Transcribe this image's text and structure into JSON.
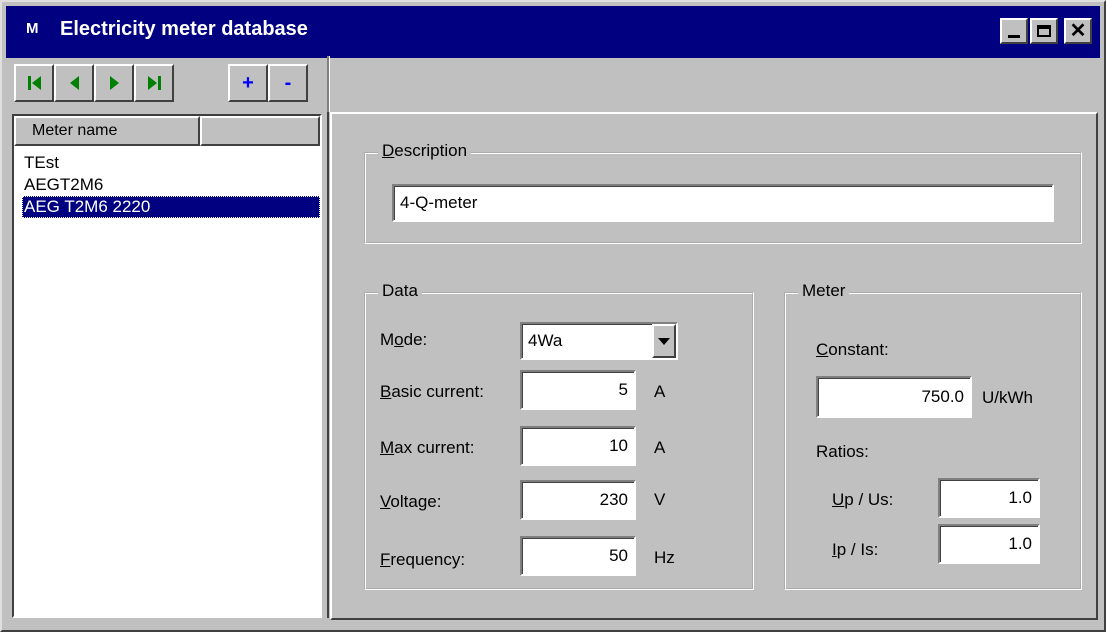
{
  "window": {
    "app_icon": "M",
    "title": "Electricity meter database",
    "controls": {
      "minimize": "minimize-icon",
      "maximize": "maximize-icon",
      "close_glyph": "✕"
    }
  },
  "toolbar": {
    "first": "first-record-icon",
    "prev": "previous-record-icon",
    "next": "next-record-icon",
    "last": "last-record-icon",
    "add": "+",
    "remove": "-"
  },
  "list": {
    "header": "Meter name",
    "items": [
      {
        "label": "TEst",
        "selected": false
      },
      {
        "label": "AEGT2M6",
        "selected": false
      },
      {
        "label": "AEG T2M6 2220",
        "selected": true
      }
    ]
  },
  "description": {
    "group_title": "Description",
    "value": "4-Q-meter"
  },
  "data": {
    "group_title": "Data",
    "mode": {
      "label_u": "o",
      "label_pre": "M",
      "label_post": "de:",
      "value": "4Wa"
    },
    "basic_current": {
      "label_u": "B",
      "label_rest": "asic current:",
      "value": "5",
      "unit": "A"
    },
    "max_current": {
      "label_u": "M",
      "label_rest": "ax current:",
      "value": "10",
      "unit": "A"
    },
    "voltage": {
      "label_u": "V",
      "label_rest": "oltage:",
      "value": "230",
      "unit": "V"
    },
    "frequency": {
      "label_u": "F",
      "label_rest": "requency:",
      "value": "50",
      "unit": "Hz"
    }
  },
  "meter": {
    "group_title": "Meter",
    "constant": {
      "label_u": "C",
      "label_rest": "onstant:",
      "value": "750.0",
      "unit": "U/kWh"
    },
    "ratios_label": "Ratios:",
    "up_us": {
      "label_u": "U",
      "label_rest": "p / Us:",
      "value": "1.0"
    },
    "ip_is": {
      "label_u": "I",
      "label_rest": "p / Is:",
      "value": "1.0"
    }
  }
}
